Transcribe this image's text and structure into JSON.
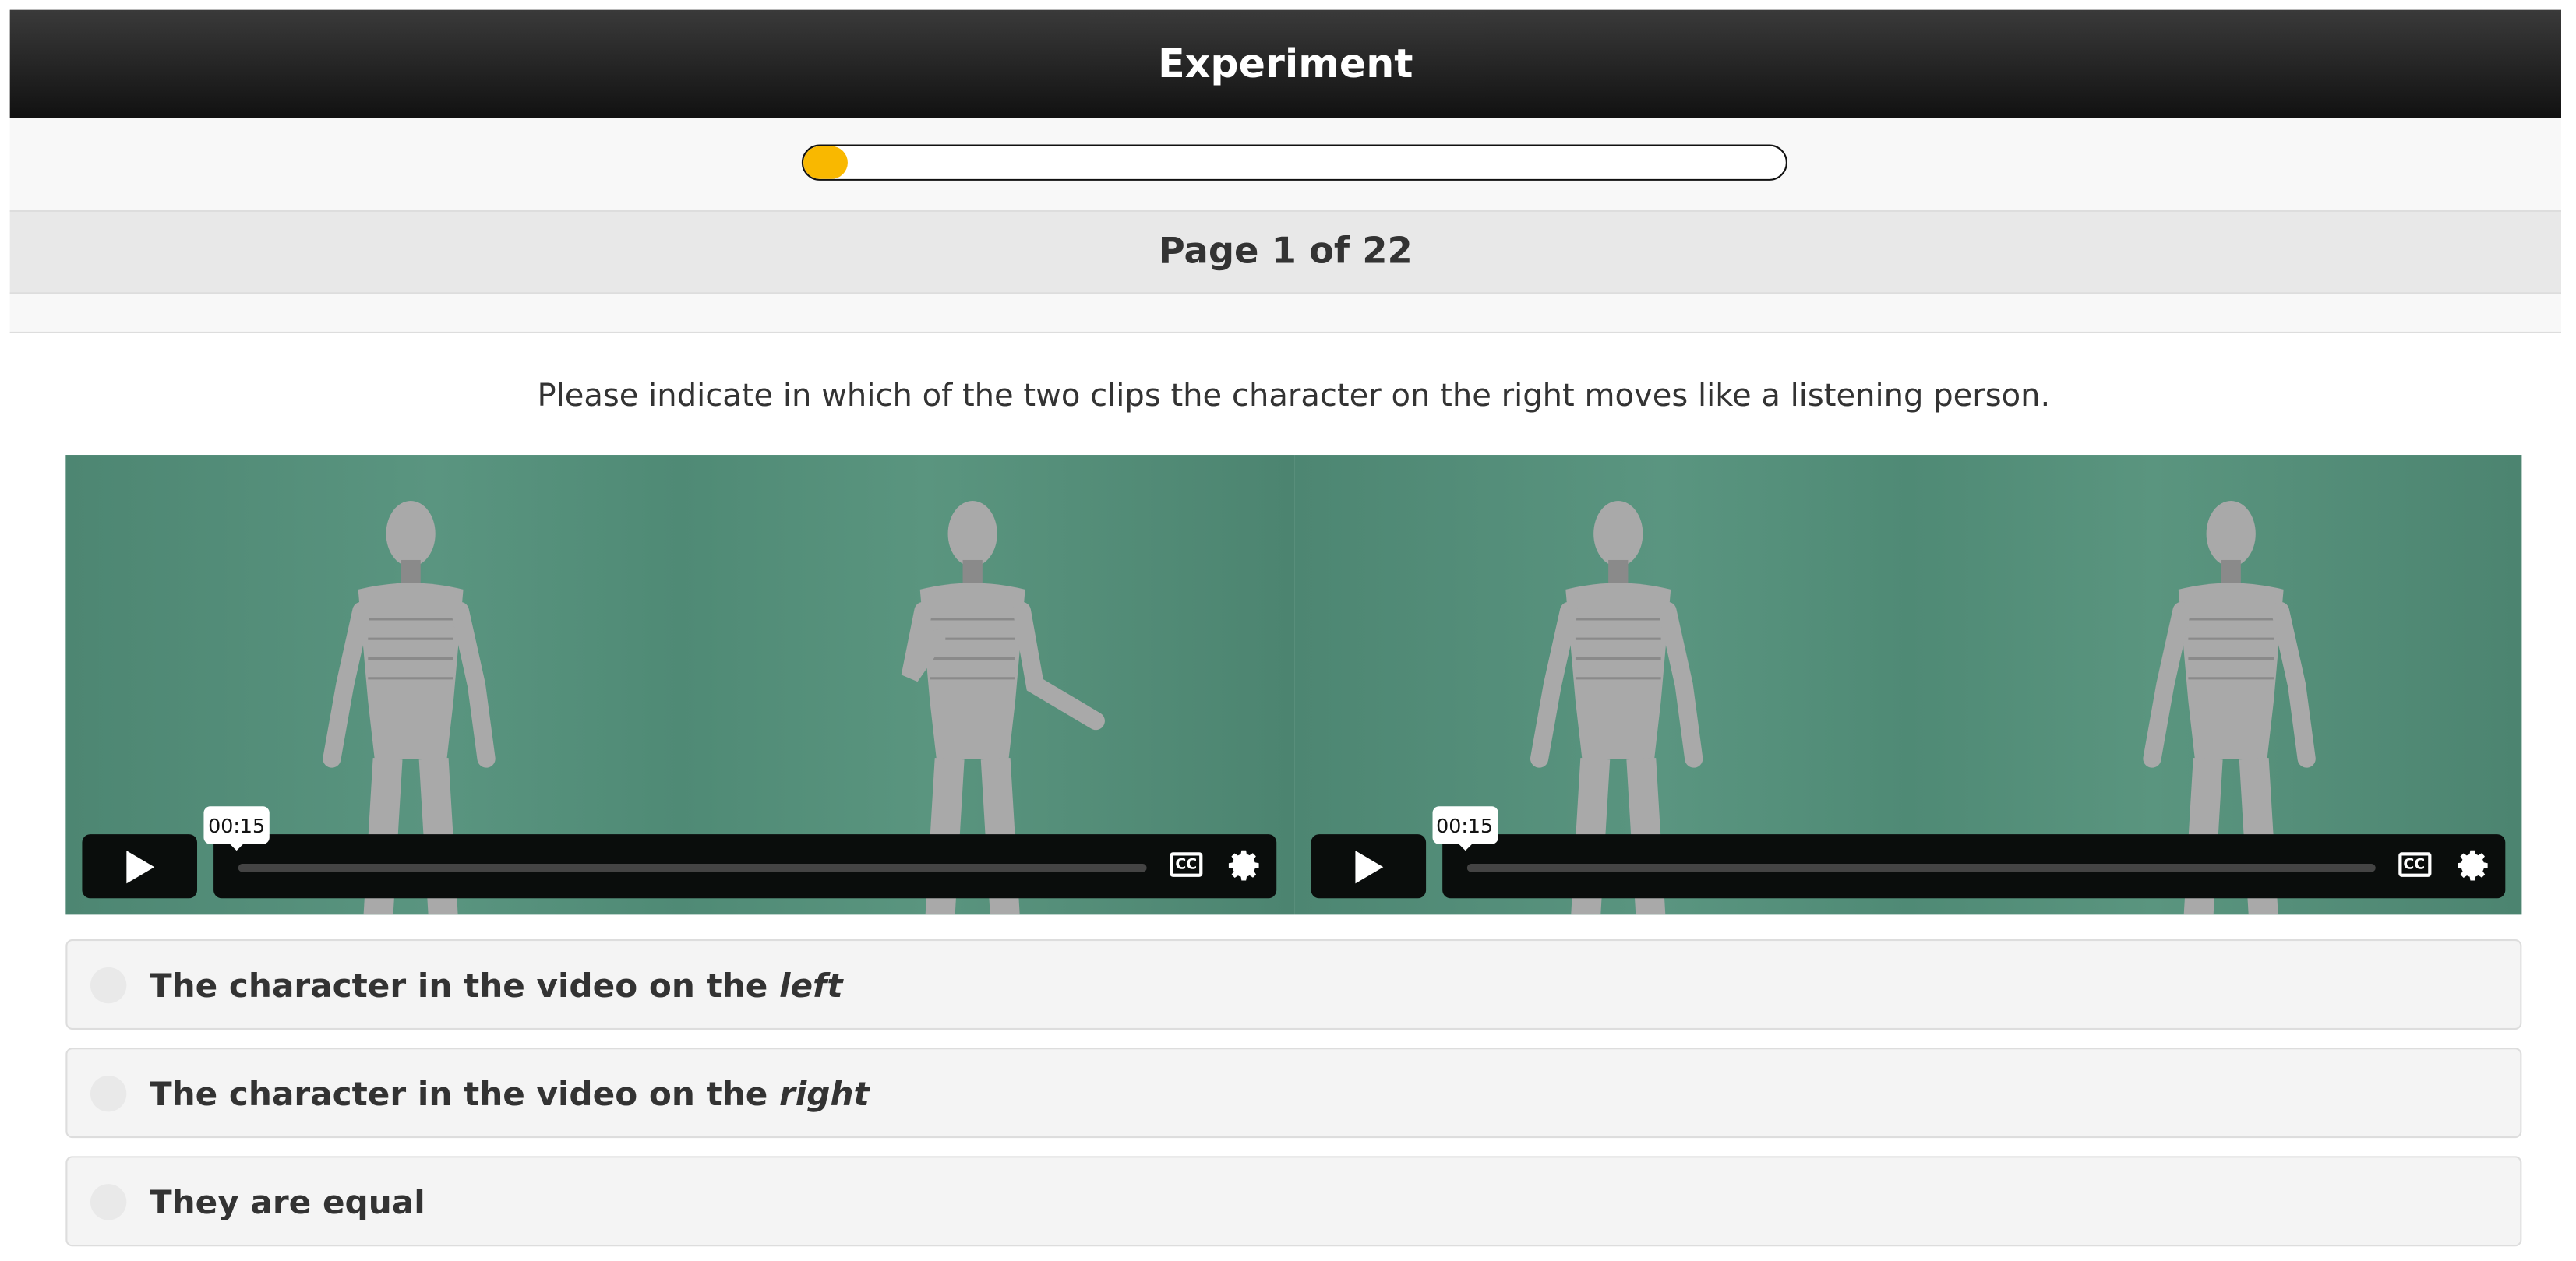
{
  "header": {
    "title": "Experiment"
  },
  "progress": {
    "percent": 4.5,
    "color": "#f9b800"
  },
  "page": {
    "label": "Page 1 of 22",
    "current": 1,
    "total": 22
  },
  "question": "Please indicate in which of the two clips the character on the right moves like a listening person.",
  "videos": [
    {
      "label": "left",
      "time_tooltip": "00:15",
      "cc_label": "CC"
    },
    {
      "label": "right",
      "time_tooltip": "00:15",
      "cc_label": "CC"
    }
  ],
  "options": [
    {
      "prefix": "The character in the video on the ",
      "emphasis": "left"
    },
    {
      "prefix": "The character in the video on the ",
      "emphasis": "right"
    },
    {
      "prefix": "They are equal",
      "emphasis": ""
    }
  ]
}
